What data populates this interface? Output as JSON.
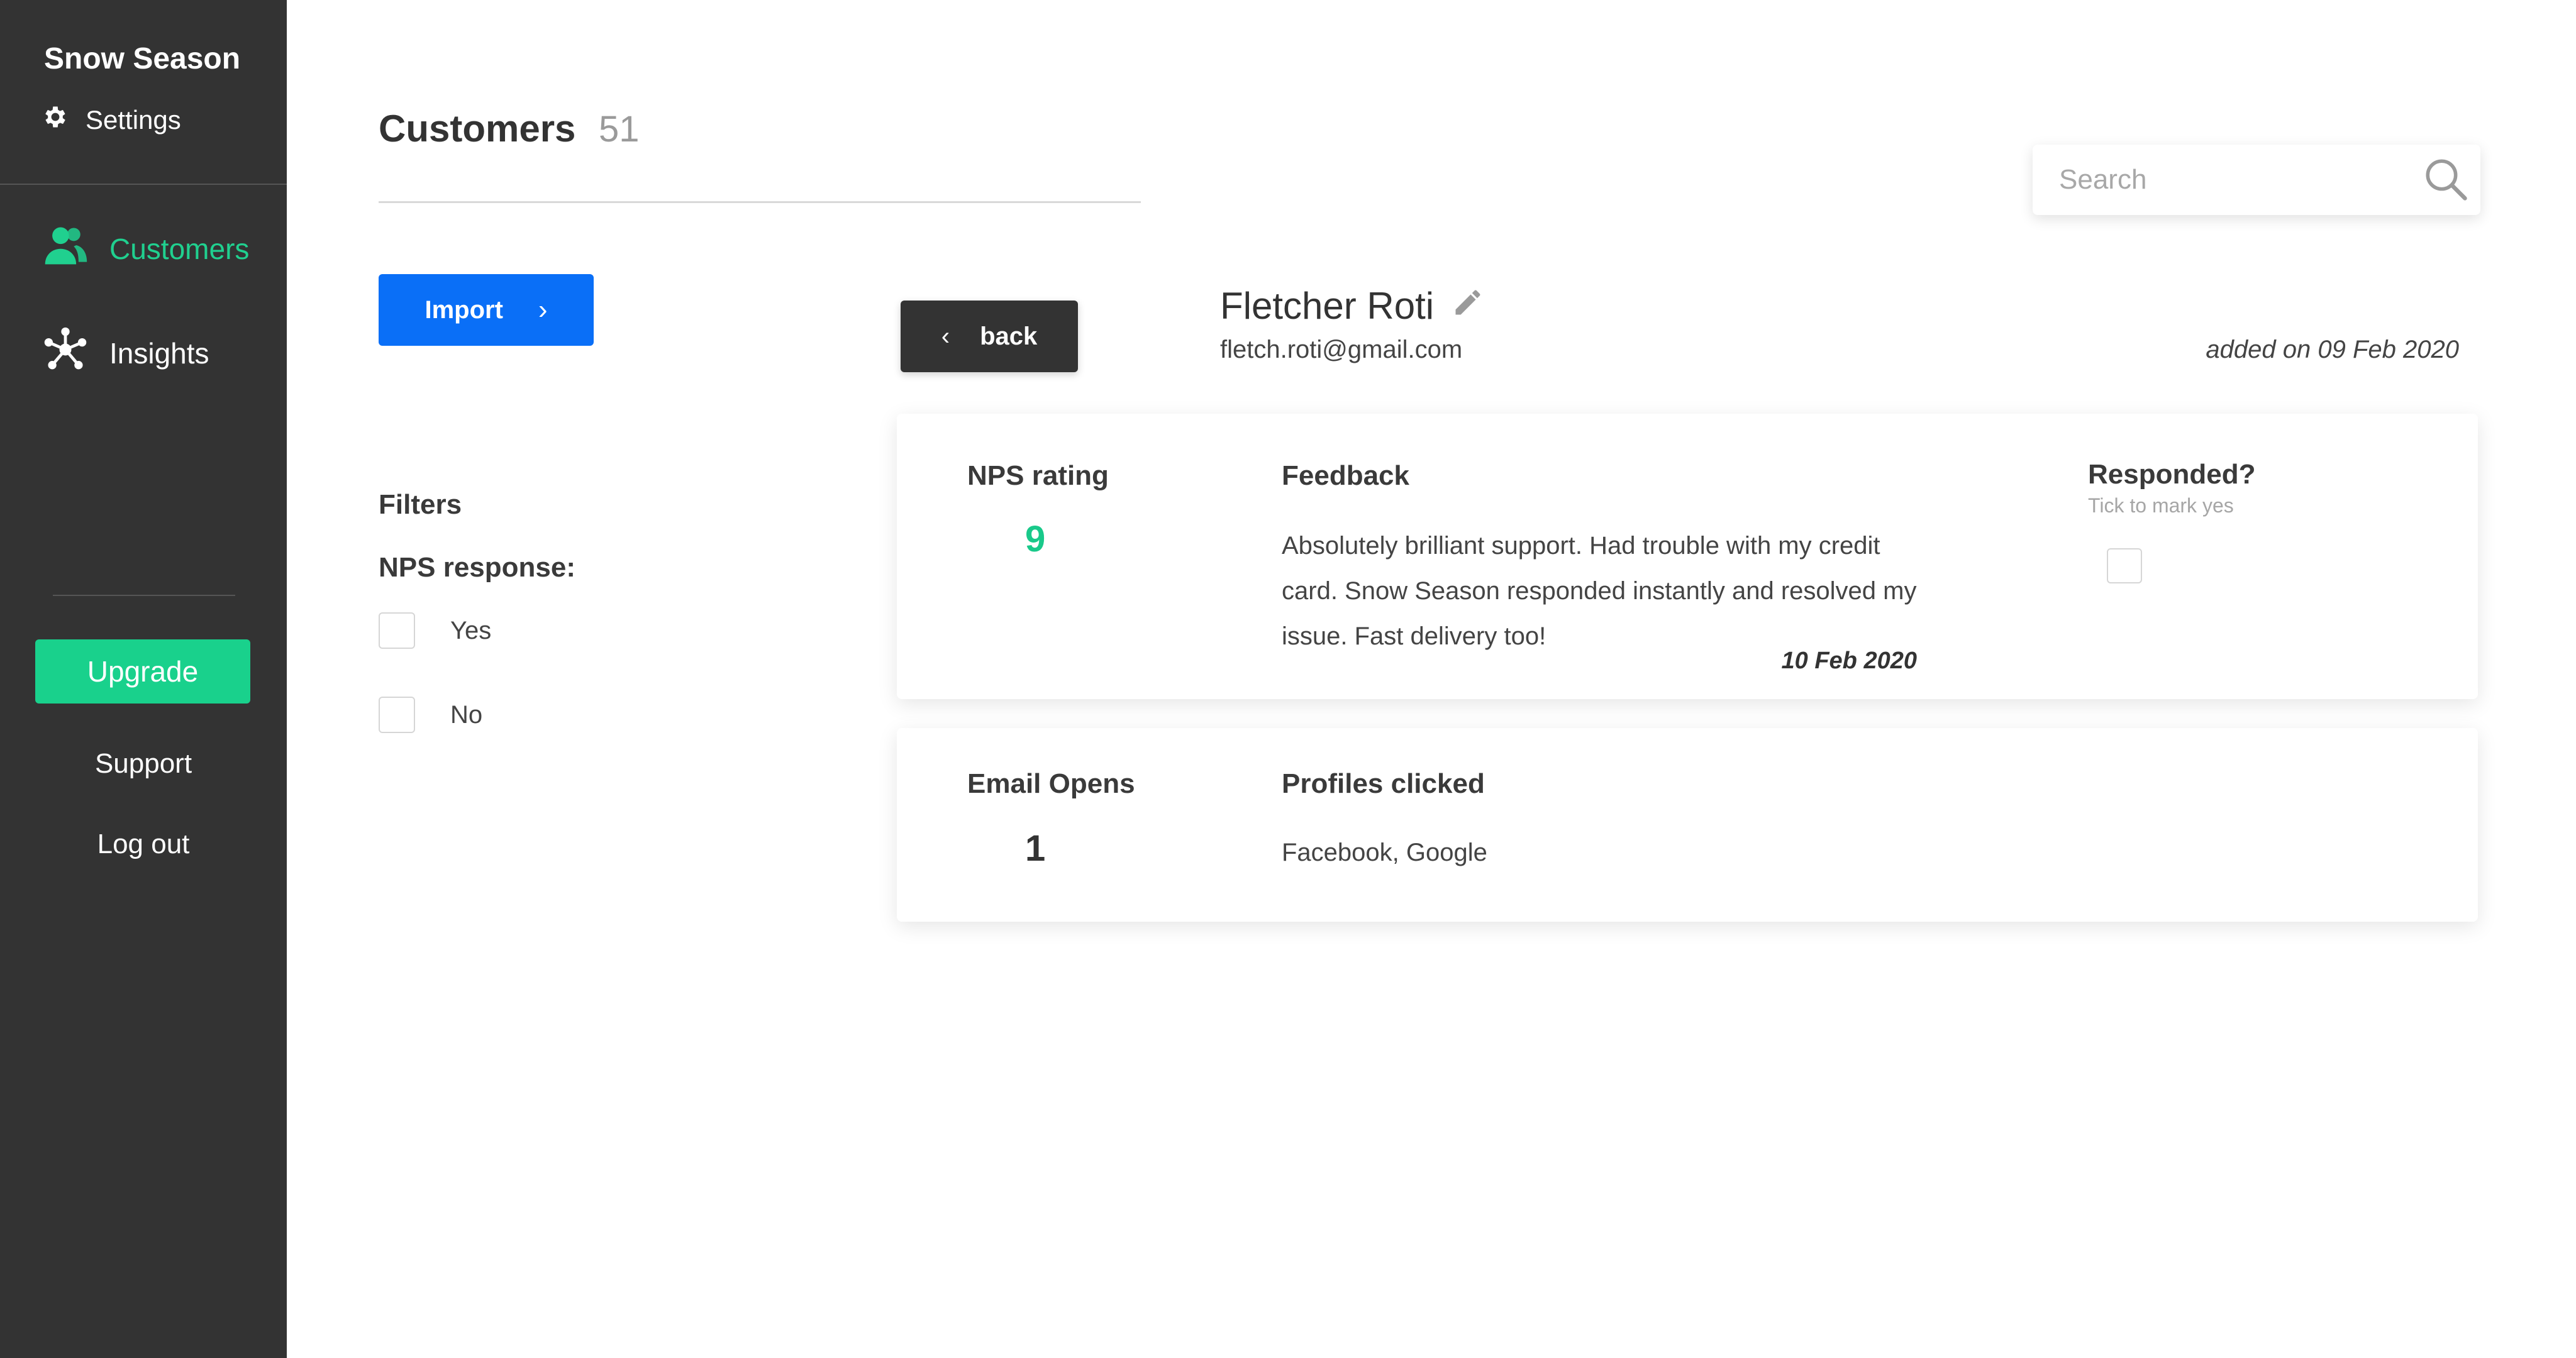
{
  "sidebar": {
    "brand": "Snow Season",
    "settings_label": "Settings",
    "nav": [
      {
        "label": "Customers",
        "icon": "users-icon",
        "active": true
      },
      {
        "label": "Insights",
        "icon": "network-icon",
        "active": false
      }
    ],
    "upgrade_label": "Upgrade",
    "support_label": "Support",
    "logout_label": "Log out"
  },
  "header": {
    "title": "Customers",
    "count": "51"
  },
  "search": {
    "placeholder": "Search"
  },
  "toolbar": {
    "import_label": "Import",
    "back_label": "back"
  },
  "filters": {
    "title": "Filters",
    "group_label": "NPS response:",
    "options": [
      {
        "label": "Yes",
        "checked": false
      },
      {
        "label": "No",
        "checked": false
      }
    ]
  },
  "customer": {
    "name": "Fletcher Roti",
    "email": "fletch.roti@gmail.com",
    "added_on": "added on 09 Feb 2020"
  },
  "feedback_card": {
    "nps_label": "NPS rating",
    "nps_value": "9",
    "feedback_label": "Feedback",
    "feedback_text": "Absolutely brilliant support. Had trouble with my credit card. Snow Season responded instantly and resolved my issue. Fast delivery too!",
    "feedback_date": "10 Feb 2020",
    "responded_label": "Responded?",
    "responded_hint": "Tick to mark yes",
    "responded_checked": false
  },
  "email_card": {
    "opens_label": "Email Opens",
    "opens_value": "1",
    "profiles_label": "Profiles clicked",
    "profiles_value": "Facebook, Google"
  },
  "colors": {
    "sidebar_bg": "#333333",
    "accent_green": "#19d18c",
    "primary_blue": "#0a6ff7"
  }
}
